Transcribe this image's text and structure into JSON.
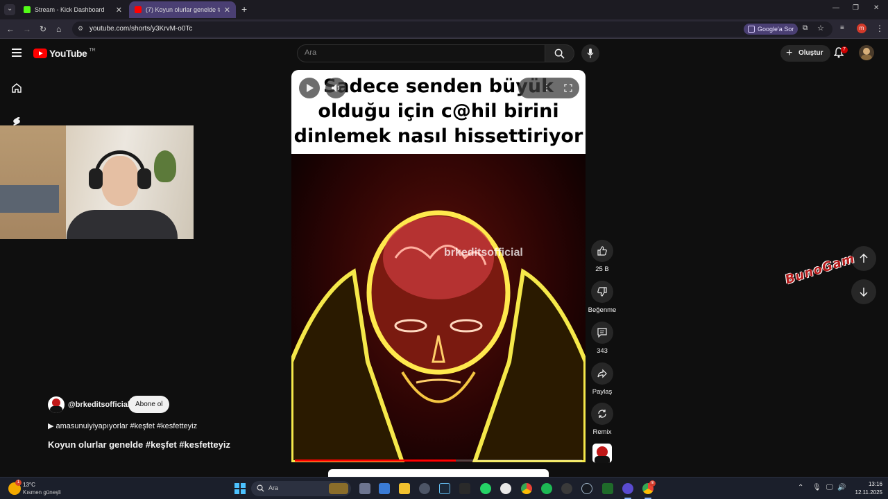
{
  "browser": {
    "tabs": [
      {
        "title": "Stream - Kick Dashboard",
        "active": false,
        "icon_color": "#53fc18"
      },
      {
        "title": "(7) Koyun olurlar genelde #keşf",
        "active": true,
        "icon_color": "#ff0000"
      }
    ],
    "url": "youtube.com/shorts/y3KrvM-o0Tc",
    "google_ask_label": "Google'a Sor",
    "profile_initial": "m"
  },
  "youtube": {
    "logo_text": "YouTube",
    "country_code": "TR",
    "search_placeholder": "Ara",
    "create_label": "Oluştur",
    "notification_count": "7"
  },
  "short": {
    "caption_lines": [
      "Sadece senden büyük",
      "olduğu için c@hil birini",
      "dinlemek nasıl hissettiriyor"
    ],
    "watermark": "brkeditsofficial",
    "progress_fraction": 0.56
  },
  "actions": {
    "likes": "25 B",
    "dislike_label": "Beğenme",
    "comments": "343",
    "share_label": "Paylaş",
    "remix_label": "Remix"
  },
  "video_meta": {
    "channel": "@brkeditsofficial",
    "subscribe_label": "Abone ol",
    "music": "amasunuiyiyapıyorlar #keşfet #kesfetteyiz",
    "title": "Koyun olurlar genelde #keşfet #kesfetteyiz"
  },
  "overlay": {
    "stream_logo": "BunoGam"
  },
  "taskbar": {
    "weather_temp": "13°C",
    "weather_desc": "Kısmen güneşli",
    "weather_badge": "1",
    "search_label": "Ara",
    "time": "13:16",
    "date": "12.11.2025",
    "chrome_badge": "m"
  },
  "colors": {
    "yt_red": "#ff0000",
    "background": "#0f0f0f",
    "chip": "#272727",
    "accent_purple": "#4a3f73"
  }
}
